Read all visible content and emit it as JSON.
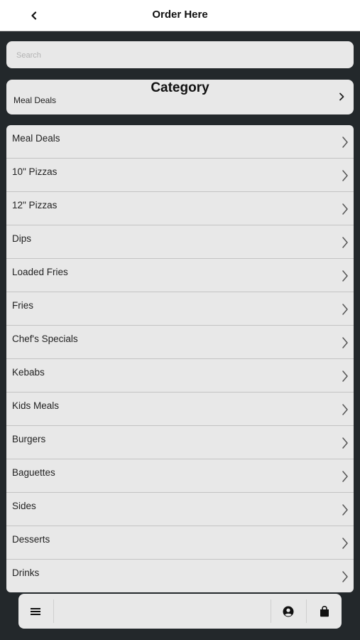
{
  "header": {
    "title": "Order Here",
    "back_icon": "chevron-left-icon"
  },
  "search": {
    "placeholder": "Search",
    "value": ""
  },
  "category": {
    "title": "Category",
    "selected": "Meal Deals",
    "icon": "chevron-right-icon"
  },
  "categories": [
    {
      "label": "Meal Deals"
    },
    {
      "label": "10\" Pizzas"
    },
    {
      "label": "12\" Pizzas"
    },
    {
      "label": "Dips"
    },
    {
      "label": "Loaded Fries"
    },
    {
      "label": "Fries"
    },
    {
      "label": "Chef's Specials"
    },
    {
      "label": "Kebabs"
    },
    {
      "label": "Kids Meals"
    },
    {
      "label": "Burgers"
    },
    {
      "label": "Baguettes"
    },
    {
      "label": "Sides"
    },
    {
      "label": "Desserts"
    },
    {
      "label": "Drinks"
    }
  ],
  "bottom_bar": {
    "menu_icon": "hamburger-menu-icon",
    "account_icon": "user-circle-icon",
    "cart_icon": "shopping-bag-icon"
  },
  "colors": {
    "background": "#23282b",
    "panel": "#e8e8e8",
    "header": "#ffffff",
    "text": "#222222"
  }
}
